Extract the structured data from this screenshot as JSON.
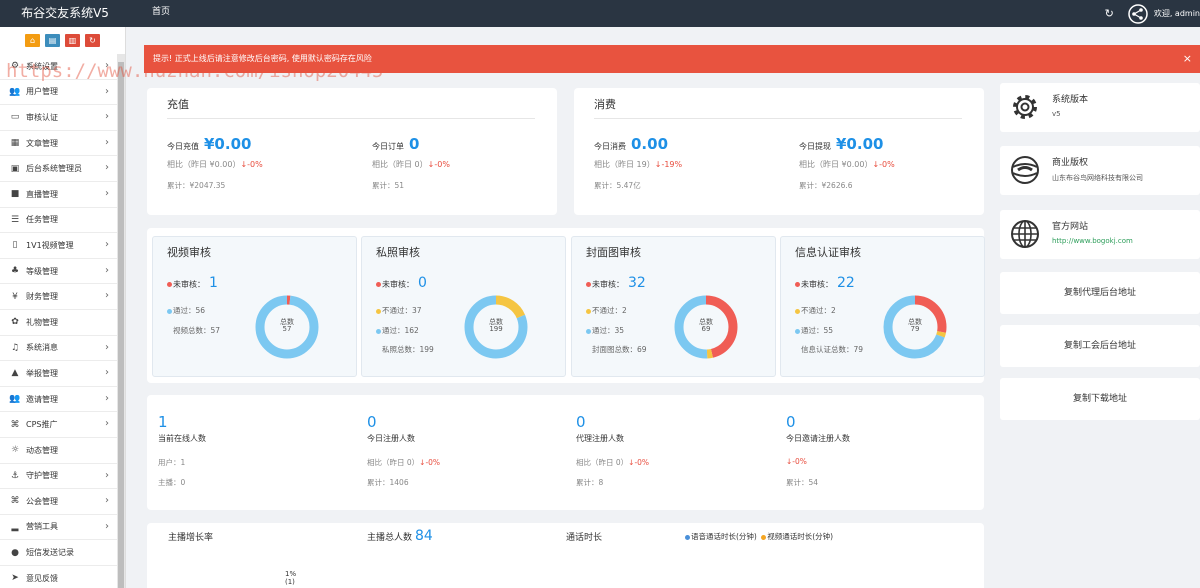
{
  "header": {
    "brand": "布谷交友系统V5",
    "home_link": "首页",
    "refresh_icon": "↻",
    "welcome": "欢迎, admin"
  },
  "sidebar": {
    "toolbar_buttons": [
      {
        "icon": "home-icon",
        "glyph": "⌂",
        "color": "#f39c12"
      },
      {
        "icon": "document-icon",
        "glyph": "▤",
        "color": "#3c8dbc"
      },
      {
        "icon": "trash-icon",
        "glyph": "▥",
        "color": "#dd4b39"
      },
      {
        "icon": "refresh-icon",
        "glyph": "↻",
        "color": "#dd4b39"
      }
    ],
    "items": [
      {
        "label": "系统设置",
        "icon": "gears-icon",
        "glyph": "⚙",
        "chevron": "›"
      },
      {
        "label": "用户管理",
        "icon": "users-icon",
        "glyph": "👥",
        "chevron": "›"
      },
      {
        "label": "审核认证",
        "icon": "id-card-icon",
        "glyph": "▭",
        "chevron": "›"
      },
      {
        "label": "文章管理",
        "icon": "grid-icon",
        "glyph": "▦",
        "chevron": "›"
      },
      {
        "label": "后台系统管理员",
        "icon": "admin-card-icon",
        "glyph": "▣",
        "chevron": "›"
      },
      {
        "label": "直播管理",
        "icon": "video-icon",
        "glyph": "■",
        "chevron": "›"
      },
      {
        "label": "任务管理",
        "icon": "server-icon",
        "glyph": "☰",
        "chevron": ""
      },
      {
        "label": "1V1视频管理",
        "icon": "video-file-icon",
        "glyph": "▯",
        "chevron": "›"
      },
      {
        "label": "等级管理",
        "icon": "sitemap-icon",
        "glyph": "♣",
        "chevron": "›"
      },
      {
        "label": "财务管理",
        "icon": "yen-icon",
        "glyph": "¥",
        "chevron": "›"
      },
      {
        "label": "礼物管理",
        "icon": "gift-icon",
        "glyph": "✿",
        "chevron": ""
      },
      {
        "label": "系统消息",
        "icon": "bell-icon",
        "glyph": "♫",
        "chevron": "›"
      },
      {
        "label": "举报管理",
        "icon": "warning-icon",
        "glyph": "▲",
        "chevron": "›"
      },
      {
        "label": "邀请管理",
        "icon": "user-group-icon",
        "glyph": "👥",
        "chevron": "›"
      },
      {
        "label": "CPS推广",
        "icon": "handshake-icon",
        "glyph": "⌘",
        "chevron": "›"
      },
      {
        "label": "动态管理",
        "icon": "lightbulb-icon",
        "glyph": "☼",
        "chevron": ""
      },
      {
        "label": "守护管理",
        "icon": "anchor-icon",
        "glyph": "⚓",
        "chevron": "›"
      },
      {
        "label": "公会管理",
        "icon": "union-icon",
        "glyph": "⌘",
        "chevron": "›"
      },
      {
        "label": "营销工具",
        "icon": "signal-icon",
        "glyph": "▂",
        "chevron": "›"
      },
      {
        "label": "短信发送记录",
        "icon": "comment-icon",
        "glyph": "●",
        "chevron": ""
      },
      {
        "label": "意见反馈",
        "icon": "send-icon",
        "glyph": "➤",
        "chevron": ""
      }
    ]
  },
  "watermark": "https://www.huzhan.com/ishop20445",
  "alert": {
    "text": "提示! 正式上线后请注意修改后台密码, 使用默认密码存在风险",
    "close": "×"
  },
  "recharge": {
    "title": "充值",
    "today_label": "今日充值",
    "today_value": "¥0.00",
    "today_cmp": "相比（昨日 ¥0.00）",
    "today_trend": "↓-0%",
    "today_total": "累计：¥2047.35",
    "order_label": "今日订单",
    "order_value": "0",
    "order_cmp": "相比（昨日 0）",
    "order_trend": "↓-0%",
    "order_total": "累计：51"
  },
  "consume": {
    "title": "消费",
    "today_label": "今日消费",
    "today_value": "0.00",
    "today_cmp": "相比（昨日 19）",
    "today_trend": "↓-19%",
    "today_total": "累计：5.47亿",
    "withdraw_label": "今日提现",
    "withdraw_value": "¥0.00",
    "withdraw_cmp": "相比（昨日 ¥0.00）",
    "withdraw_trend": "↓-0%",
    "withdraw_total": "累计：¥2626.6"
  },
  "review_cards": [
    {
      "title": "视频审核",
      "pending_label": "未审核：",
      "pending_value": "1",
      "row2": "通过：56",
      "row2_color": "#7cc8f1",
      "row3": "视频总数：57",
      "row3_dot": false,
      "total_label": "总数",
      "total": "57",
      "segments": [
        {
          "value": 1,
          "color": "#f05d55"
        },
        {
          "value": 56,
          "color": "#7cc8f1"
        }
      ]
    },
    {
      "title": "私照审核",
      "pending_label": "未审核：",
      "pending_value": "0",
      "row2": "不通过：37",
      "row2_color": "#f5c542",
      "row3": "通过：162",
      "row3_dot": true,
      "row4": "私照总数：199",
      "total_label": "总数",
      "total": "199",
      "segments": [
        {
          "value": 0,
          "color": "#f05d55"
        },
        {
          "value": 37,
          "color": "#f5c542"
        },
        {
          "value": 162,
          "color": "#7cc8f1"
        }
      ]
    },
    {
      "title": "封面图审核",
      "pending_label": "未审核：",
      "pending_value": "32",
      "row2": "不通过：2",
      "row2_color": "#f5c542",
      "row3": "通过：35",
      "row3_dot": true,
      "row4": "封面图总数：69",
      "total_label": "总数",
      "total": "69",
      "segments": [
        {
          "value": 32,
          "color": "#f05d55"
        },
        {
          "value": 2,
          "color": "#f5c542"
        },
        {
          "value": 35,
          "color": "#7cc8f1"
        }
      ]
    },
    {
      "title": "信息认证审核",
      "pending_label": "未审核：",
      "pending_value": "22",
      "row2": "不通过：2",
      "row2_color": "#f5c542",
      "row3": "通过：55",
      "row3_dot": true,
      "row4": "信息认证总数：79",
      "total_label": "总数",
      "total": "79",
      "segments": [
        {
          "value": 22,
          "color": "#f05d55"
        },
        {
          "value": 2,
          "color": "#f5c542"
        },
        {
          "value": 55,
          "color": "#7cc8f1"
        }
      ]
    }
  ],
  "registrations": [
    {
      "value": "1",
      "label": "当前在线人数",
      "l1": "用户：1",
      "l2": "主播：0"
    },
    {
      "value": "0",
      "label": "今日注册人数",
      "l1": "相比（昨日 0）",
      "l1_trend": "↓-0%",
      "l2": "累计：1406"
    },
    {
      "value": "0",
      "label": "代理注册人数",
      "l1": "相比（昨日 0）",
      "l1_trend": "↓-0%",
      "l2": "累计：8"
    },
    {
      "value": "0",
      "label": "今日邀请注册人数",
      "l1_trend": "↓-0%",
      "l2": "累计：54"
    }
  ],
  "bottom": {
    "growth_title": "主播增长率",
    "anchor_total_label": "主播总人数",
    "anchor_total_value": "84",
    "call_title": "通话时长",
    "legend_voice": "语音通话时长(分钟)",
    "legend_video": "视频通话时长(分钟)",
    "pct_label": "1%",
    "pct_count": "(1)"
  },
  "info_panel": {
    "version_title": "系统版本",
    "version_value": "v5",
    "copyright_title": "商业版权",
    "copyright_value": "山东布谷鸟网络科技有限公司",
    "site_title": "官方网站",
    "site_value": "http://www.bogokj.com",
    "copy_agent": "复制代理后台地址",
    "copy_guild": "复制工会后台地址",
    "copy_download": "复制下载地址"
  },
  "colors": {
    "accent": "#1e90e6",
    "alert": "#e8533f",
    "header": "#2a3542",
    "danger": "#e84c3d",
    "link_green": "#2e9e5b"
  }
}
